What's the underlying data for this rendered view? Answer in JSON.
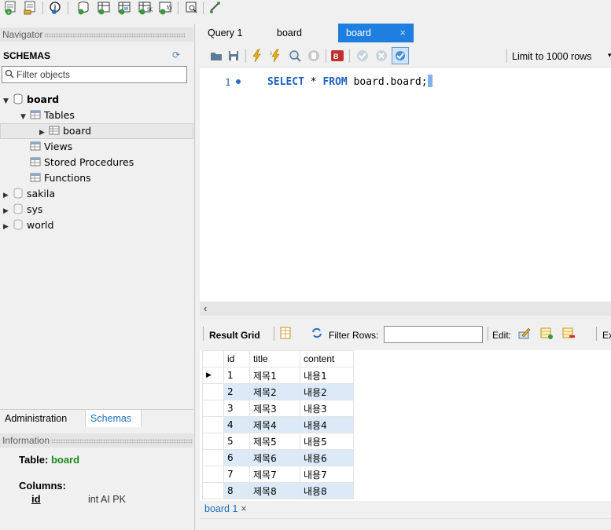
{
  "toolbar": {
    "icons": [
      "new-sql-tab-icon",
      "open-sql-file-icon",
      "open-inspector-icon",
      "create-schema-icon",
      "create-table-icon",
      "create-view-icon",
      "create-procedure-icon",
      "create-function-icon",
      "search-table-data-icon",
      "reconnect-icon"
    ]
  },
  "navigator": {
    "header": "Navigator",
    "schemas_title": "SCHEMAS",
    "filter_placeholder": "Filter objects",
    "tree": [
      {
        "label": "board",
        "expanded": true,
        "bold": true
      },
      {
        "label": "Tables",
        "expanded": true
      },
      {
        "label": "board",
        "selected": true
      },
      {
        "label": "Views"
      },
      {
        "label": "Stored Procedures"
      },
      {
        "label": "Functions"
      },
      {
        "label": "sakila"
      },
      {
        "label": "sys"
      },
      {
        "label": "world"
      }
    ],
    "tabs": {
      "administration": "Administration",
      "schemas": "Schemas"
    }
  },
  "information": {
    "header": "Information",
    "table_prefix": "Table: ",
    "table_name": "board",
    "columns_label": "Columns:",
    "column_name": "id",
    "column_type": "int AI PK"
  },
  "query_tabs": [
    {
      "label": "Query 1"
    },
    {
      "label": "board"
    },
    {
      "label": "board",
      "active": true,
      "close": "×"
    }
  ],
  "query_toolbar": {
    "limit_label": "Limit to 1000 rows",
    "limit_arrow": "▾"
  },
  "editor": {
    "line_number": "1",
    "sql_kw1": "SELECT",
    "sql_mid": " * ",
    "sql_kw2": "FROM",
    "sql_rest": " board.board",
    "sql_end": ";"
  },
  "result_bar": {
    "result_grid": "Result Grid",
    "filter_rows": "Filter Rows:",
    "edit": "Edit:",
    "export": "Ex"
  },
  "grid": {
    "columns": [
      "id",
      "title",
      "content"
    ],
    "rows": [
      [
        "1",
        "제목1",
        "내용1"
      ],
      [
        "2",
        "제목2",
        "내용2"
      ],
      [
        "3",
        "제목3",
        "내용3"
      ],
      [
        "4",
        "제목4",
        "내용4"
      ],
      [
        "5",
        "제목5",
        "내용5"
      ],
      [
        "6",
        "제목6",
        "내용6"
      ],
      [
        "7",
        "제목7",
        "내용7"
      ],
      [
        "8",
        "제목8",
        "내용8"
      ]
    ]
  },
  "bottom_tab": {
    "label": "board 1",
    "close": "×"
  },
  "colors": {
    "accent": "#1e7fe0",
    "row_alt": "#dceaf8",
    "keyword": "#2060c0",
    "info_green": "#1a8a1a"
  }
}
